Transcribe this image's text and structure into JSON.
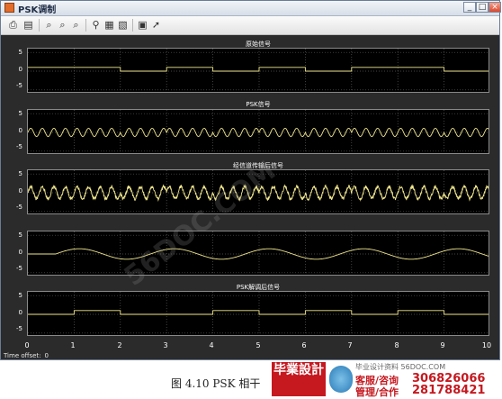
{
  "window": {
    "title": "PSK调制"
  },
  "window_buttons": {
    "minimize": "_",
    "maximize": "□",
    "close": "×"
  },
  "toolbar": [
    "print-icon",
    "params-icon",
    "zoom-in-icon",
    "zoom-x-icon",
    "zoom-y-icon",
    "autoscale-icon",
    "save-axes-icon",
    "restore-axes-icon",
    "float-icon",
    "select-icon"
  ],
  "plots": [
    {
      "title": "原始信号",
      "yticks": [
        "5",
        "0",
        "-5"
      ],
      "kind": "binary"
    },
    {
      "title": "PSK信号",
      "yticks": [
        "5",
        "0",
        "-5"
      ],
      "kind": "psk"
    },
    {
      "title": "经信道传输后信号",
      "yticks": [
        "5",
        "0",
        "-5"
      ],
      "kind": "noisy"
    },
    {
      "title": "",
      "yticks": [
        "5",
        "0",
        "-5"
      ],
      "kind": "lowfreq"
    },
    {
      "title": "PSK解调后信号",
      "yticks": [
        "5",
        "0",
        "-5"
      ],
      "kind": "demod"
    }
  ],
  "xaxis": {
    "ticks": [
      "0",
      "1",
      "2",
      "3",
      "4",
      "5",
      "6",
      "7",
      "8",
      "9",
      "10"
    ]
  },
  "signal": {
    "bits_original": [
      1,
      1,
      0,
      1,
      0,
      1,
      0,
      1,
      1,
      0
    ],
    "bits_demod": [
      0,
      1,
      0,
      0,
      1,
      0,
      1,
      0,
      1,
      0
    ],
    "colors": {
      "trace": "#f0e68c",
      "background": "#000000",
      "grid": "#5a5a5a"
    }
  },
  "time_offset": {
    "label": "Time offset:",
    "value": "0"
  },
  "watermark": "56DOC.COM",
  "caption": "图 4.10    PSK 相干",
  "banner": {
    "logo": "毕業設計",
    "subtitle": "毕业设计资料 56DOC.COM",
    "service1": "客服/咨询",
    "service2": "管理/合作",
    "phone1": "306826066",
    "phone2": "281788421"
  }
}
